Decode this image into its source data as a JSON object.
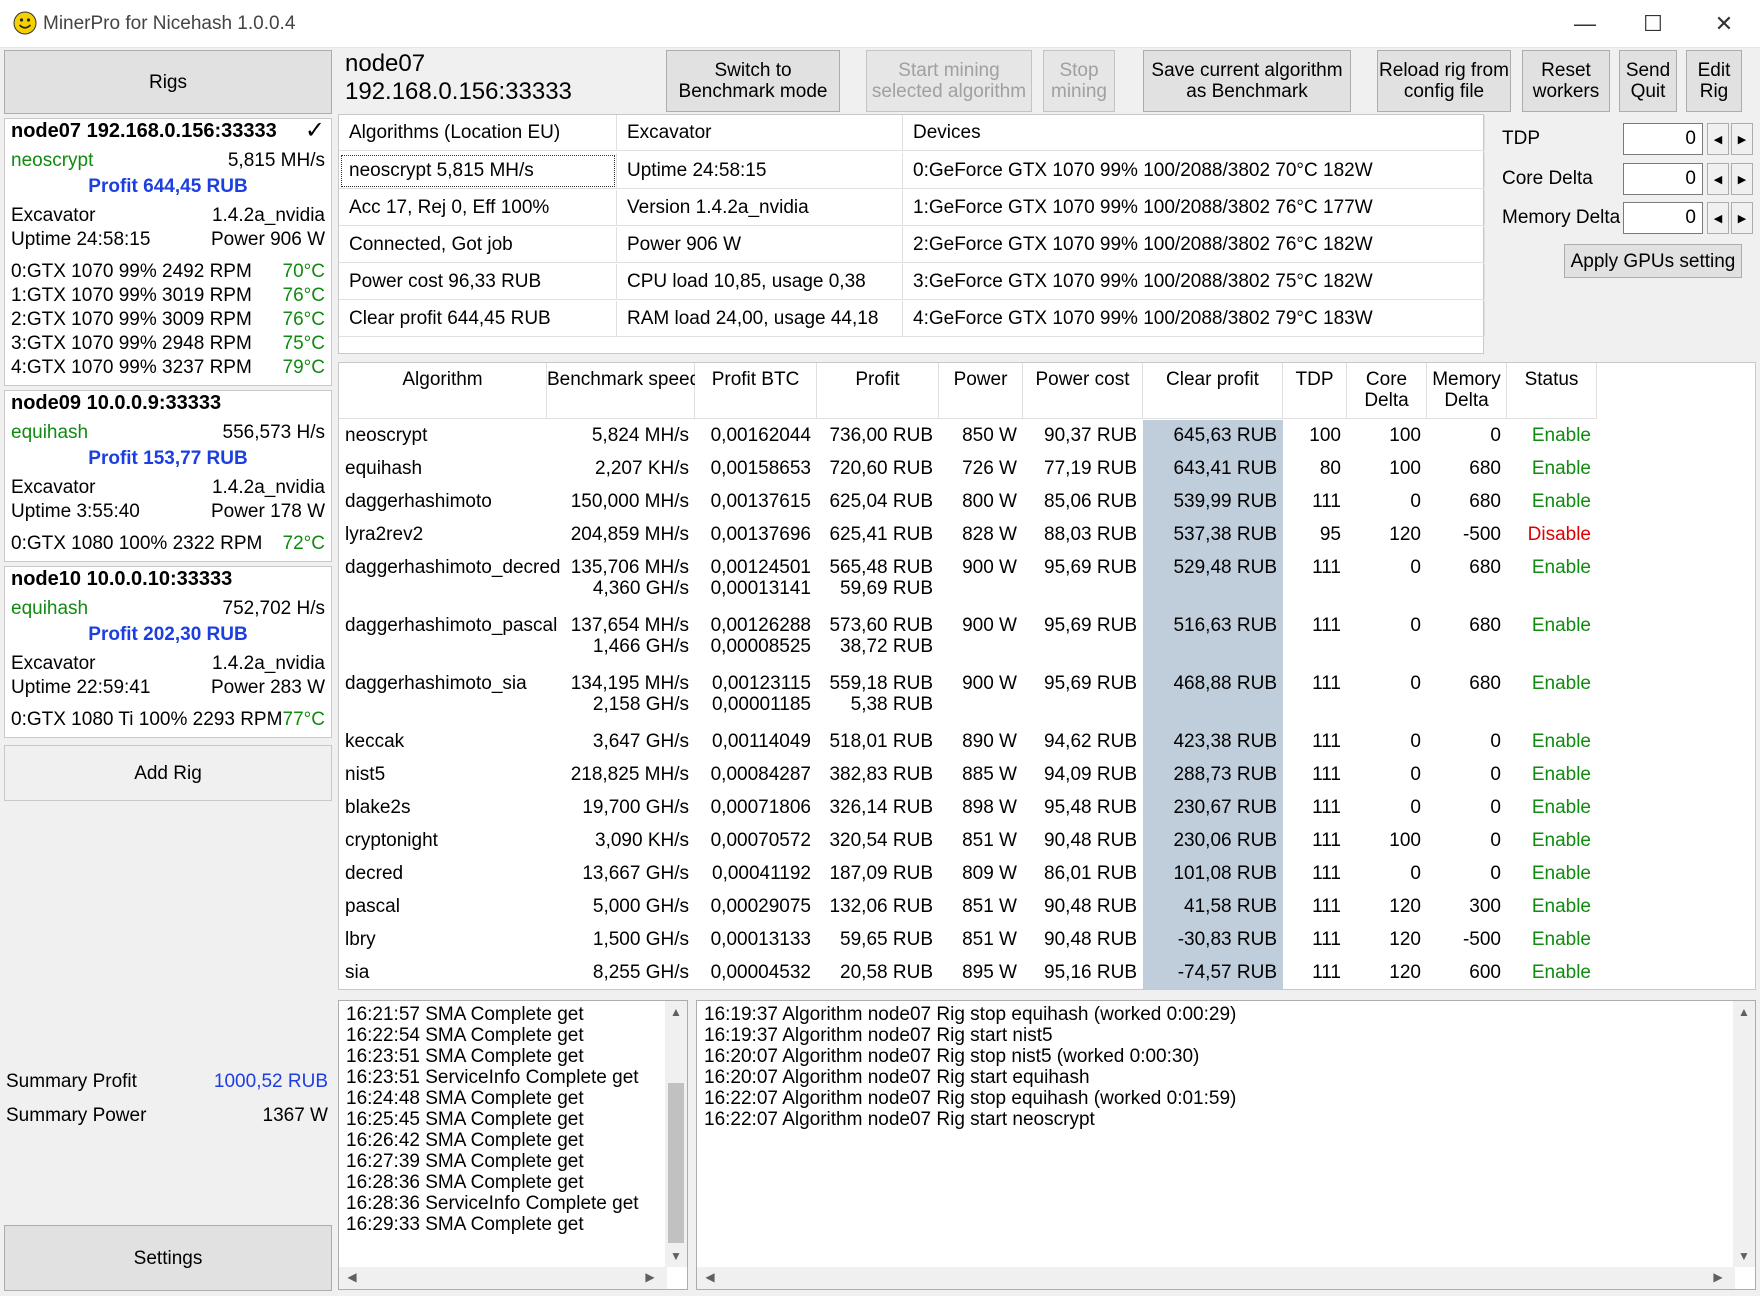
{
  "window": {
    "title": "MinerPro for Nicehash 1.0.0.4",
    "controls": {
      "minimize": "—",
      "maximize": "☐",
      "close": "✕"
    }
  },
  "left": {
    "rigs_label": "Rigs",
    "add_rig_label": "Add Rig",
    "settings_label": "Settings",
    "summary_profit_label": "Summary Profit",
    "summary_profit_value": "1000,52 RUB",
    "summary_power_label": "Summary Power",
    "summary_power_value": "1367 W",
    "rigs": [
      {
        "title": "node07 192.168.0.156:33333",
        "check": "✓",
        "algo": "neoscrypt",
        "speed": "5,815 MH/s",
        "profit": "Profit 644,45 RUB",
        "miner": "Excavator",
        "version": "1.4.2a_nvidia",
        "uptime": "Uptime 24:58:15",
        "power": "Power 906 W",
        "gpus": [
          {
            "desc": "0:GTX 1070  99% 2492 RPM",
            "temp": "70°C"
          },
          {
            "desc": "1:GTX 1070  99% 3019 RPM",
            "temp": "76°C"
          },
          {
            "desc": "2:GTX 1070  99% 3009 RPM",
            "temp": "76°C"
          },
          {
            "desc": "3:GTX 1070  99% 2948 RPM",
            "temp": "75°C"
          },
          {
            "desc": "4:GTX 1070  99% 3237 RPM",
            "temp": "79°C"
          }
        ]
      },
      {
        "title": "node09 10.0.0.9:33333",
        "algo": "equihash",
        "speed": "556,573 H/s",
        "profit": "Profit 153,77 RUB",
        "miner": "Excavator",
        "version": "1.4.2a_nvidia",
        "uptime": "Uptime 3:55:40",
        "power": "Power 178 W",
        "gpus": [
          {
            "desc": "0:GTX 1080 100% 2322 RPM",
            "temp": "72°C"
          }
        ]
      },
      {
        "title": "node10 10.0.0.10:33333",
        "algo": "equihash",
        "speed": "752,702 H/s",
        "profit": "Profit 202,30 RUB",
        "miner": "Excavator",
        "version": "1.4.2a_nvidia",
        "uptime": "Uptime 22:59:41",
        "power": "Power 283 W",
        "gpus": [
          {
            "desc": "0:GTX 1080 Ti 100% 2293 RPM",
            "temp": "77°C"
          }
        ]
      }
    ]
  },
  "header": {
    "node_name": "node07",
    "node_addr": "192.168.0.156:33333",
    "buttons": {
      "benchmark": [
        "Switch to",
        "Benchmark mode"
      ],
      "start": [
        "Start mining",
        "selected algorithm"
      ],
      "stop": [
        "Stop",
        "mining"
      ],
      "save": [
        "Save current algorithm",
        "as Benchmark"
      ],
      "reload": [
        "Reload rig from",
        "config file"
      ],
      "reset": [
        "Reset",
        "workers"
      ],
      "send_quit": [
        "Send",
        "Quit"
      ],
      "edit_rig": [
        "Edit",
        "Rig"
      ]
    }
  },
  "info": {
    "headers": [
      "Algorithms (Location EU)",
      "Excavator",
      "Devices"
    ],
    "rows": [
      [
        "neoscrypt 5,815 MH/s",
        "Uptime 24:58:15",
        "0:GeForce GTX 1070 99% 100/2088/3802 70°C 182W"
      ],
      [
        "Acc 17, Rej 0, Eff 100%",
        "Version 1.4.2a_nvidia",
        "1:GeForce GTX 1070 99% 100/2088/3802 76°C 177W"
      ],
      [
        "Connected, Got job",
        "Power 906 W",
        "2:GeForce GTX 1070 99% 100/2088/3802 76°C 182W"
      ],
      [
        "Power cost 96,33 RUB",
        "CPU load 10,85, usage 0,38",
        "3:GeForce GTX 1070 99% 100/2088/3802 75°C 182W"
      ],
      [
        "Clear profit 644,45 RUB",
        "RAM load 24,00, usage 44,18",
        "4:GeForce GTX 1070 99% 100/2088/3802 79°C 183W"
      ]
    ]
  },
  "gpu_settings": {
    "tdp_label": "TDP",
    "tdp_value": "0",
    "core_label": "Core Delta",
    "core_value": "0",
    "mem_label": "Memory Delta",
    "mem_value": "0",
    "apply_label": "Apply GPUs setting"
  },
  "table": {
    "columns": [
      "Algorithm",
      "Benchmark speed",
      "Profit BTC",
      "Profit",
      "Power",
      "Power cost",
      "Clear profit",
      "TDP",
      "Core\nDelta",
      "Memory\nDelta",
      "Status"
    ],
    "rows": [
      {
        "algo": "neoscrypt",
        "speed": [
          "5,824 MH/s"
        ],
        "btc": [
          "0,00162044"
        ],
        "profit": [
          "736,00 RUB"
        ],
        "power": "850 W",
        "cost": "90,37 RUB",
        "clear": "645,63 RUB",
        "tdp": "100",
        "core": "100",
        "mem": "0",
        "status": "Enable"
      },
      {
        "algo": "equihash",
        "speed": [
          "2,207 KH/s"
        ],
        "btc": [
          "0,00158653"
        ],
        "profit": [
          "720,60 RUB"
        ],
        "power": "726 W",
        "cost": "77,19 RUB",
        "clear": "643,41 RUB",
        "tdp": "80",
        "core": "100",
        "mem": "680",
        "status": "Enable"
      },
      {
        "algo": "daggerhashimoto",
        "speed": [
          "150,000 MH/s"
        ],
        "btc": [
          "0,00137615"
        ],
        "profit": [
          "625,04 RUB"
        ],
        "power": "800 W",
        "cost": "85,06 RUB",
        "clear": "539,99 RUB",
        "tdp": "111",
        "core": "0",
        "mem": "680",
        "status": "Enable"
      },
      {
        "algo": "lyra2rev2",
        "speed": [
          "204,859 MH/s"
        ],
        "btc": [
          "0,00137696"
        ],
        "profit": [
          "625,41 RUB"
        ],
        "power": "828 W",
        "cost": "88,03 RUB",
        "clear": "537,38 RUB",
        "tdp": "95",
        "core": "120",
        "mem": "-500",
        "status": "Disable"
      },
      {
        "algo": "daggerhashimoto_decred",
        "speed": [
          "135,706 MH/s",
          "4,360 GH/s"
        ],
        "btc": [
          "0,00124501",
          "0,00013141"
        ],
        "profit": [
          "565,48 RUB",
          "59,69 RUB"
        ],
        "power": "900 W",
        "cost": "95,69 RUB",
        "clear": "529,48 RUB",
        "tdp": "111",
        "core": "0",
        "mem": "680",
        "status": "Enable"
      },
      {
        "algo": "daggerhashimoto_pascal",
        "speed": [
          "137,654 MH/s",
          "1,466 GH/s"
        ],
        "btc": [
          "0,00126288",
          "0,00008525"
        ],
        "profit": [
          "573,60 RUB",
          "38,72 RUB"
        ],
        "power": "900 W",
        "cost": "95,69 RUB",
        "clear": "516,63 RUB",
        "tdp": "111",
        "core": "0",
        "mem": "680",
        "status": "Enable"
      },
      {
        "algo": "daggerhashimoto_sia",
        "speed": [
          "134,195 MH/s",
          "2,158 GH/s"
        ],
        "btc": [
          "0,00123115",
          "0,00001185"
        ],
        "profit": [
          "559,18 RUB",
          "5,38 RUB"
        ],
        "power": "900 W",
        "cost": "95,69 RUB",
        "clear": "468,88 RUB",
        "tdp": "111",
        "core": "0",
        "mem": "680",
        "status": "Enable"
      },
      {
        "algo": "keccak",
        "speed": [
          "3,647 GH/s"
        ],
        "btc": [
          "0,00114049"
        ],
        "profit": [
          "518,01 RUB"
        ],
        "power": "890 W",
        "cost": "94,62 RUB",
        "clear": "423,38 RUB",
        "tdp": "111",
        "core": "0",
        "mem": "0",
        "status": "Enable"
      },
      {
        "algo": "nist5",
        "speed": [
          "218,825 MH/s"
        ],
        "btc": [
          "0,00084287"
        ],
        "profit": [
          "382,83 RUB"
        ],
        "power": "885 W",
        "cost": "94,09 RUB",
        "clear": "288,73 RUB",
        "tdp": "111",
        "core": "0",
        "mem": "0",
        "status": "Enable"
      },
      {
        "algo": "blake2s",
        "speed": [
          "19,700 GH/s"
        ],
        "btc": [
          "0,00071806"
        ],
        "profit": [
          "326,14 RUB"
        ],
        "power": "898 W",
        "cost": "95,48 RUB",
        "clear": "230,67 RUB",
        "tdp": "111",
        "core": "0",
        "mem": "0",
        "status": "Enable"
      },
      {
        "algo": "cryptonight",
        "speed": [
          "3,090 KH/s"
        ],
        "btc": [
          "0,00070572"
        ],
        "profit": [
          "320,54 RUB"
        ],
        "power": "851 W",
        "cost": "90,48 RUB",
        "clear": "230,06 RUB",
        "tdp": "111",
        "core": "100",
        "mem": "0",
        "status": "Enable"
      },
      {
        "algo": "decred",
        "speed": [
          "13,667 GH/s"
        ],
        "btc": [
          "0,00041192"
        ],
        "profit": [
          "187,09 RUB"
        ],
        "power": "809 W",
        "cost": "86,01 RUB",
        "clear": "101,08 RUB",
        "tdp": "111",
        "core": "0",
        "mem": "0",
        "status": "Enable"
      },
      {
        "algo": "pascal",
        "speed": [
          "5,000 GH/s"
        ],
        "btc": [
          "0,00029075"
        ],
        "profit": [
          "132,06 RUB"
        ],
        "power": "851 W",
        "cost": "90,48 RUB",
        "clear": "41,58 RUB",
        "tdp": "111",
        "core": "120",
        "mem": "300",
        "status": "Enable"
      },
      {
        "algo": "lbry",
        "speed": [
          "1,500 GH/s"
        ],
        "btc": [
          "0,00013133"
        ],
        "profit": [
          "59,65 RUB"
        ],
        "power": "851 W",
        "cost": "90,48 RUB",
        "clear": "-30,83 RUB",
        "tdp": "111",
        "core": "120",
        "mem": "-500",
        "status": "Enable"
      },
      {
        "algo": "sia",
        "speed": [
          "8,255 GH/s"
        ],
        "btc": [
          "0,00004532"
        ],
        "profit": [
          "20,58 RUB"
        ],
        "power": "895 W",
        "cost": "95,16 RUB",
        "clear": "-74,57 RUB",
        "tdp": "111",
        "core": "120",
        "mem": "600",
        "status": "Enable"
      }
    ]
  },
  "logs": {
    "left": [
      "16:21:57 SMA Complete get",
      "16:22:54 SMA Complete get",
      "16:23:51 SMA Complete get",
      "16:23:51 ServiceInfo Complete get",
      "16:24:48 SMA Complete get",
      "16:25:45 SMA Complete get",
      "16:26:42 SMA Complete get",
      "16:27:39 SMA Complete get",
      "16:28:36 SMA Complete get",
      "16:28:36 ServiceInfo Complete get",
      "16:29:33 SMA Complete get"
    ],
    "right": [
      "16:19:37 Algorithm node07 Rig stop equihash (worked 0:00:29)",
      "16:19:37 Algorithm node07 Rig start nist5",
      "16:20:07 Algorithm node07 Rig stop nist5 (worked 0:00:30)",
      "16:20:07 Algorithm node07 Rig start equihash",
      "16:22:07 Algorithm node07 Rig stop equihash (worked 0:01:59)",
      "16:22:07 Algorithm node07 Rig start neoscrypt"
    ]
  },
  "colors": {
    "enable": "#108a10",
    "disable": "#e00000",
    "profit": "#1d3ee0",
    "clear_bg": "#c0cedc"
  }
}
